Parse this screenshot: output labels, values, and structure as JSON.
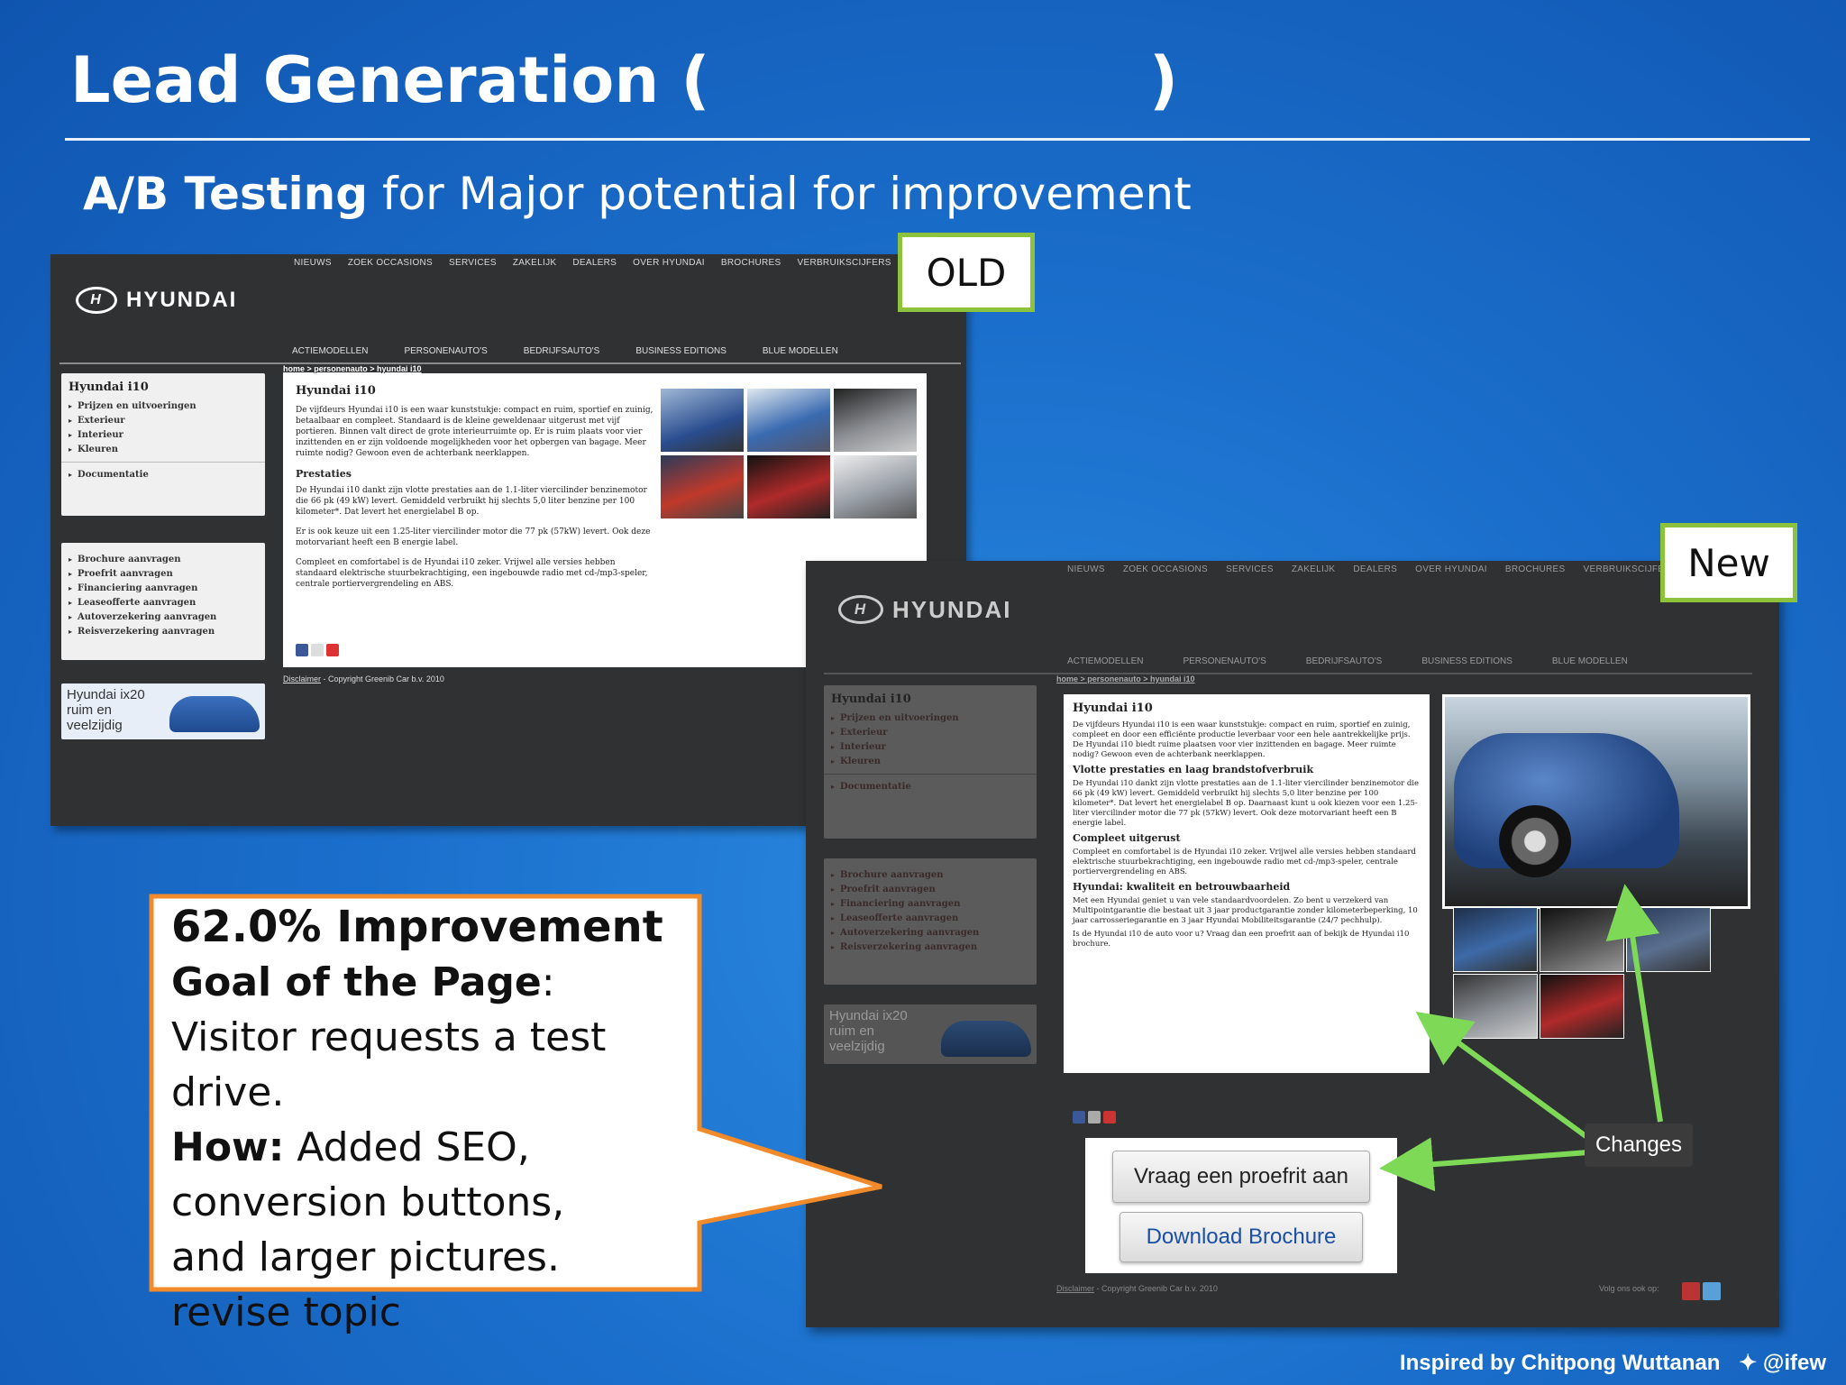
{
  "slide": {
    "title": "Lead Generation (                    )",
    "subtitle_bold": "A/B Testing",
    "subtitle_rest": " for Major potential for improvement",
    "old_label": "OLD",
    "new_label": "New",
    "credit_text": "Inspired by Chitpong Wuttanan",
    "credit_handle": "@ifew",
    "changes_label": "Changes"
  },
  "callout": {
    "line1": "62.0% Improvement",
    "goal_label": "Goal of the Page",
    "goal_text": ": Visitor requests a test drive.",
    "how_label": "How:",
    "how_text": " Added SEO, conversion buttons, and larger pictures. revise topic"
  },
  "old_site": {
    "brand": "HYUNDAI",
    "top_nav": [
      "NIEUWS",
      "ZOEK OCCASIONS",
      "SERVICES",
      "ZAKELIJK",
      "DEALERS",
      "OVER HYUNDAI",
      "BROCHURES",
      "VERBRUIKSCIJFERS"
    ],
    "sub_nav": [
      "ACTIEMODELLEN",
      "PERSONENAUTO'S",
      "BEDRIJFSAUTO'S",
      "BUSINESS EDITIONS",
      "BLUE MODELLEN"
    ],
    "breadcrumb": "home > personenauto > hyundai i10",
    "side_title": "Hyundai i10",
    "side_items": [
      "Prijzen en uitvoeringen",
      "Exterieur",
      "Interieur",
      "Kleuren"
    ],
    "side_doc": "Documentatie",
    "side_actions": [
      "Brochure aanvragen",
      "Proefrit aanvragen",
      "Financiering aanvragen",
      "Leaseofferte aanvragen",
      "Autoverzekering aanvragen",
      "Reisverzekering aanvragen"
    ],
    "ad_text": "Hyundai ix20 ruim en veelzijdig",
    "content_title": "Hyundai i10",
    "p1": "De vijfdeurs Hyundai i10 is een waar kunststukje: compact en ruim, sportief en zuinig, betaalbaar en compleet. Standaard is de kleine geweldenaar uitgerust met vijf portieren. Binnen valt direct de grote interieurruimte op. Er is ruim plaats voor vier inzittenden en er zijn voldoende mogelijkheden voor het opbergen van bagage. Meer ruimte nodig? Gewoon even de achterbank neerklappen.",
    "prestaties": "Prestaties",
    "p2": "De Hyundai i10 dankt zijn vlotte prestaties aan de 1.1-liter viercilinder benzinemotor die 66 pk (49 kW) levert. Gemiddeld verbruikt hij slechts 5,0 liter benzine per 100 kilometer*. Dat levert het energielabel B op.",
    "p3": "Er is ook keuze uit een 1.25-liter viercilinder motor die 77 pk (57kW) levert. Ook deze motorvariant heeft een B energie label.",
    "p4": "Compleet en comfortabel is de Hyundai i10 zeker. Vrijwel alle versies hebben standaard elektrische stuurbekrachtiging, een ingebouwde radio met cd-/mp3-speler, centrale portiervergrendeling en ABS.",
    "footer_link": "Disclaimer",
    "footer_text": " - Copyright Greenib Car b.v. 2010"
  },
  "new_site": {
    "brand": "HYUNDAI",
    "top_nav": [
      "NIEUWS",
      "ZOEK OCCASIONS",
      "SERVICES",
      "ZAKELIJK",
      "DEALERS",
      "OVER HYUNDAI",
      "BROCHURES",
      "VERBRUIKSCIJFERS"
    ],
    "sub_nav": [
      "ACTIEMODELLEN",
      "PERSONENAUTO'S",
      "BEDRIJFSAUTO'S",
      "BUSINESS EDITIONS",
      "BLUE MODELLEN"
    ],
    "breadcrumb": "home > personenauto > hyundai i10",
    "side_title": "Hyundai i10",
    "side_items": [
      "Prijzen en uitvoeringen",
      "Exterieur",
      "Interieur",
      "Kleuren"
    ],
    "side_doc": "Documentatie",
    "side_actions": [
      "Brochure aanvragen",
      "Proefrit aanvragen",
      "Financiering aanvragen",
      "Leaseofferte aanvragen",
      "Autoverzekering aanvragen",
      "Reisverzekering aanvragen"
    ],
    "ad_text": "Hyundai ix20 ruim en veelzijdig",
    "content_title": "Hyundai i10",
    "p1": "De vijfdeurs Hyundai i10 is een waar kunststukje: compact en ruim, sportief en zuinig, compleet en door een efficiënte productie leverbaar voor een hele aantrekkelijke prijs. De Hyundai i10 biedt ruime plaatsen voor vier inzittenden en bagage. Meer ruimte nodig? Gewoon even de achterbank neerklappen.",
    "s1": "Vlotte prestaties en laag brandstofverbruik",
    "p2": "De Hyundai i10 dankt zijn vlotte prestaties aan de 1.1-liter viercilinder benzinemotor die 66 pk (49 kW) levert. Gemiddeld verbruikt hij slechts 5,0 liter benzine per 100 kilometer*. Dat levert het energielabel B op. Daarnaast kunt u ook kiezen voor een 1.25-liter viercilinder motor die 77 pk (57kW) levert. Ook deze motorvariant heeft een B energie label.",
    "s2": "Compleet uitgerust",
    "p3": "Compleet en comfortabel is de Hyundai i10 zeker. Vrijwel alle versies hebben standaard elektrische stuurbekrachtiging, een ingebouwde radio met cd-/mp3-speler, centrale portiervergrendeling en ABS.",
    "s3": "Hyundai: kwaliteit en betrouwbaarheid",
    "p4": "Met een Hyundai geniet u van vele standaardvoordelen. Zo bent u verzekerd van Multipointgarantie die bestaat uit 3 jaar productgarantie zonder kilometerbeperking, 10 jaar carrosseriegarantie en 3 jaar Hyundai Mobiliteitsgarantie (24/7 pechhulp).",
    "p5": "Is de Hyundai i10 de auto voor u? Vraag dan een proefrit aan of bekijk de Hyundai i10 brochure.",
    "cta_testdrive": "Vraag een proefrit aan",
    "cta_brochure": "Download Brochure",
    "footer_link": "Disclaimer",
    "footer_text": " - Copyright Greenib Car b.v. 2010",
    "follow_text": "Volg ons ook op:"
  },
  "colors": {
    "accent_green": "#8dc23d",
    "arrow_green": "#7ed957",
    "callout_border": "#f08a2a",
    "link_blue": "#1a4fa3"
  }
}
